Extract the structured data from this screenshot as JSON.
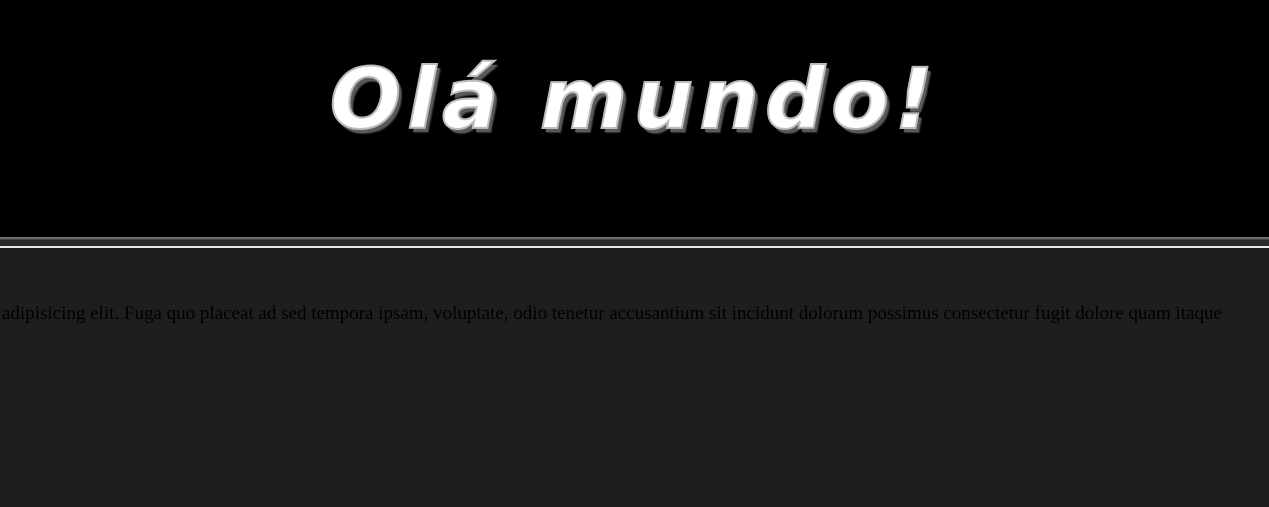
{
  "header": {
    "title": "Olá mundo!"
  },
  "main": {
    "scrolling_text": "adipisicing elit. Fuga quo placeat ad sed tempora ipsam, voluptate, odio tenetur accusantium sit incidunt dolorum possimus consectetur fugit dolore quam itaque"
  },
  "colors": {
    "header_background": "#000000",
    "page_background": "#1e1e1e",
    "title_text": "#ffffff",
    "body_text": "#000000",
    "divider": "#e8e8e8"
  }
}
